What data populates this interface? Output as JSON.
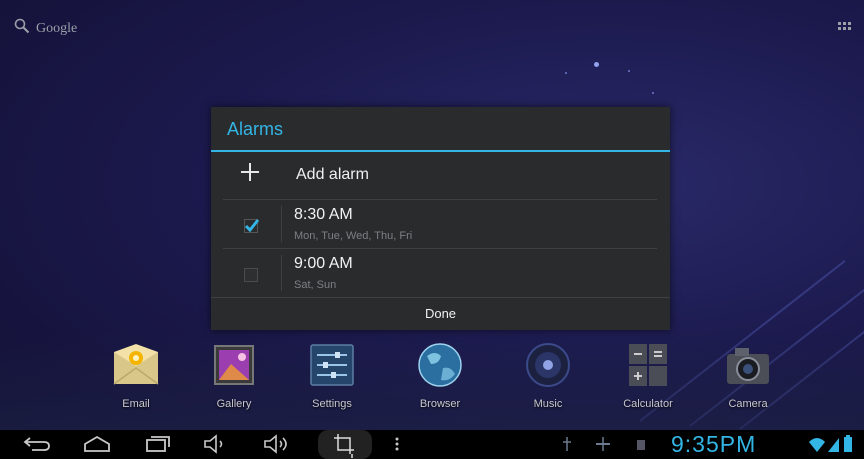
{
  "search": {
    "label": "Google",
    "icon": "search-icon"
  },
  "apps_button": {
    "icon": "all-apps-grid-icon"
  },
  "dialog": {
    "title": "Alarms",
    "add_label": "Add alarm",
    "alarms": [
      {
        "time": "8:30 AM",
        "days": "Mon, Tue, Wed, Thu, Fri",
        "enabled": true
      },
      {
        "time": "9:00 AM",
        "days": "Sat, Sun",
        "enabled": false
      }
    ],
    "done_label": "Done"
  },
  "dock": [
    {
      "label": "Email",
      "icon": "email-icon"
    },
    {
      "label": "Gallery",
      "icon": "gallery-icon"
    },
    {
      "label": "Settings",
      "icon": "settings-icon"
    },
    {
      "label": "Browser",
      "icon": "browser-globe-icon"
    },
    {
      "label": "Music",
      "icon": "music-speaker-icon"
    },
    {
      "label": "Calculator",
      "icon": "calculator-icon"
    },
    {
      "label": "Camera",
      "icon": "camera-icon"
    }
  ],
  "status": {
    "time": "9:35PM"
  },
  "colors": {
    "accent": "#33b5e5",
    "dialog_bg": "#2a2b2d",
    "navbar": "#000000"
  }
}
